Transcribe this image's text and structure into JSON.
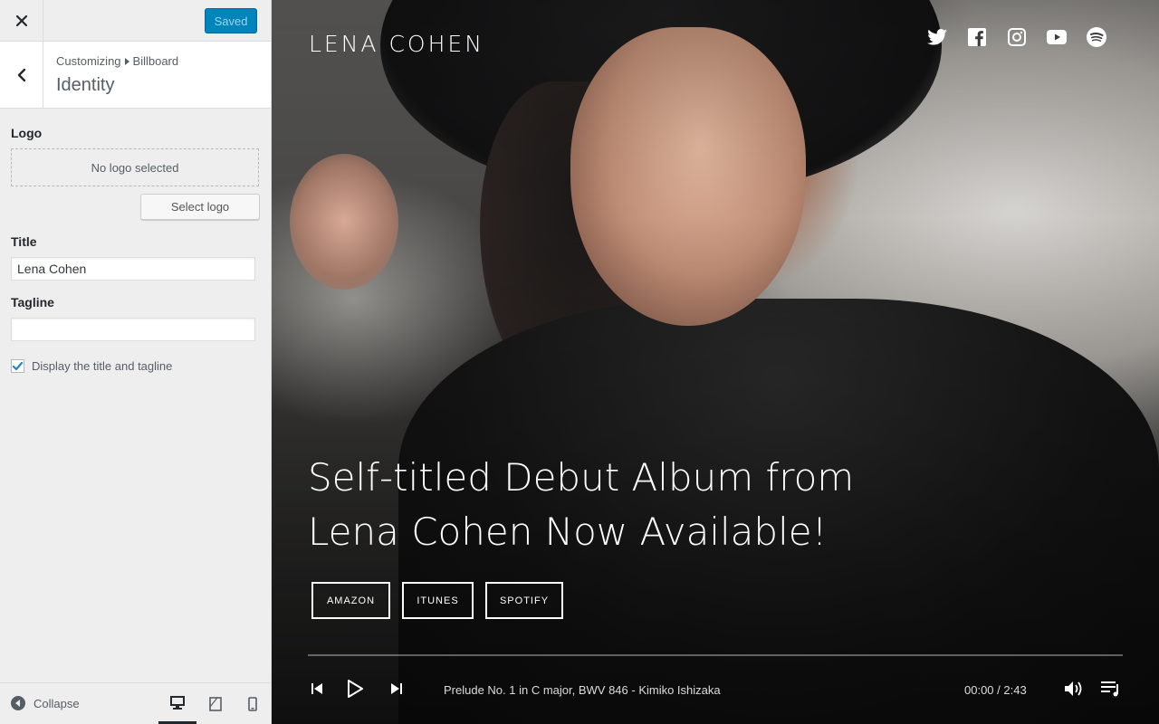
{
  "customizer": {
    "save_status": "Saved",
    "breadcrumb": {
      "root": "Customizing",
      "section": "Billboard"
    },
    "section_title": "Identity",
    "logo": {
      "label": "Logo",
      "placeholder": "No logo selected",
      "select_button": "Select logo"
    },
    "title_field": {
      "label": "Title",
      "value": "Lena Cohen"
    },
    "tagline_field": {
      "label": "Tagline",
      "value": ""
    },
    "display_checkbox": {
      "label": "Display the title and tagline",
      "checked": true
    },
    "footer": {
      "collapse_label": "Collapse",
      "devices": [
        "desktop",
        "tablet",
        "mobile"
      ],
      "active_device": "desktop"
    }
  },
  "preview": {
    "site_title": "LENA COHEN",
    "social_icons": [
      "twitter-icon",
      "facebook-icon",
      "instagram-icon",
      "youtube-icon",
      "spotify-icon"
    ],
    "headline": "Self-titled Debut Album from Lena Cohen Now Available!",
    "buttons": {
      "amazon": "AMAZON",
      "itunes": "ITUNES",
      "spotify": "SPOTIFY"
    },
    "player": {
      "track": "Prelude No. 1 in C major, BWV 846 - Kimiko Ishizaka",
      "time": "00:00 / 2:43",
      "progress": 0
    }
  },
  "colors": {
    "primary_button": "#0085ba",
    "panel_bg": "#eeeeee",
    "text": "#555d66"
  }
}
